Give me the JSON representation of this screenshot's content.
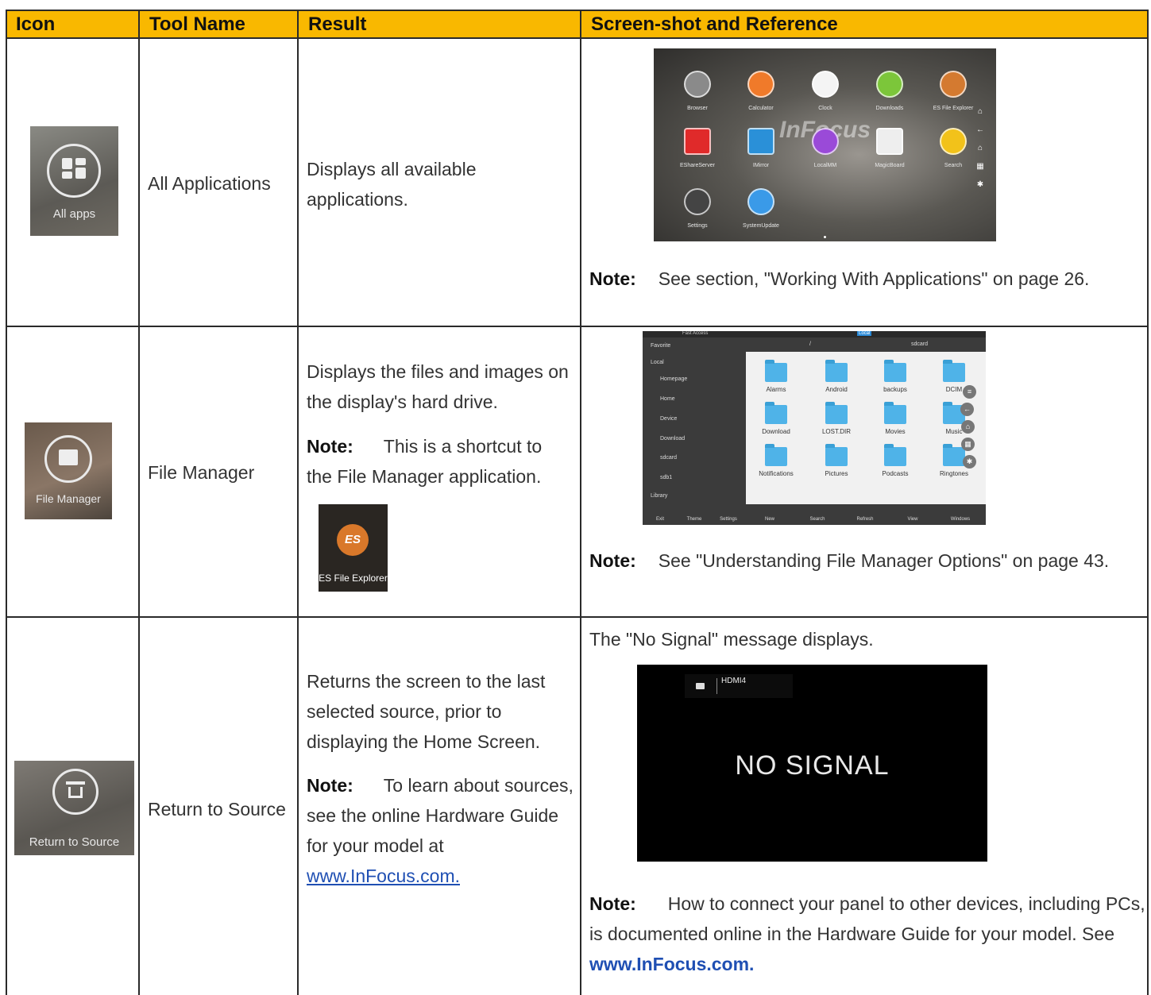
{
  "headers": [
    "Icon",
    "Tool Name",
    "Result",
    "Screen-shot and Reference"
  ],
  "rows": [
    {
      "icon_caption": "All apps",
      "tool_name": "All Applications",
      "result": "Displays all available applications.",
      "screenshot": {
        "watermark": "InFocus",
        "apps": [
          "Browser",
          "Calculator",
          "Clock",
          "Downloads",
          "ES File Explorer",
          "EShareServer",
          "IMirror",
          "LocalMM",
          "MagicBoard",
          "Search",
          "Settings",
          "SystemUpdate"
        ]
      },
      "note_label": "Note:",
      "note_text": "See section, \"Working With Applications\" on page 26."
    },
    {
      "icon_caption": "File Manager",
      "tool_name": "File Manager",
      "result": "Displays the files and images on the display's hard drive.",
      "result_note_label": "Note:",
      "result_note_text": "This is a shortcut to the File Manager application.",
      "inline_icon_caption": "ES File Explorer",
      "inline_icon_glyph": "ES",
      "screenshot": {
        "top_left": "Fast Access",
        "top_center": "Local",
        "path_root": "/",
        "path_current": "sdcard",
        "sidebar": [
          "Favorite",
          "Local",
          "Homepage",
          "Home",
          "Device",
          "Download",
          "sdcard",
          "sdb1",
          "Library"
        ],
        "folders": [
          "Alarms",
          "Android",
          "backups",
          "DCIM",
          "Download",
          "LOST.DIR",
          "Movies",
          "Music",
          "Notifications",
          "Pictures",
          "Podcasts",
          "Ringtones"
        ],
        "bottom_left": [
          "Exit",
          "Theme",
          "Settings"
        ],
        "bottom_right": [
          "New",
          "Search",
          "Refresh",
          "View",
          "Windows"
        ]
      },
      "note_label": "Note:",
      "note_text": "See \"Understanding File Manager Options\" on page 43."
    },
    {
      "icon_caption": "Return to Source",
      "tool_name": "Return to Source",
      "result": "Returns the screen to the last selected source, prior to displaying the Home Screen.",
      "result_note_label": "Note:",
      "result_note_text": "To learn about sources, see the online Hardware Guide for your model at",
      "result_link": "www.InFocus.com.",
      "intro": "The \"No Signal\" message displays.",
      "screenshot": {
        "source_label": "HDMI4",
        "message": "NO SIGNAL"
      },
      "note_label": "Note:",
      "note_text": "How to connect your panel to other devices, including PCs, is documented online in the Hardware Guide for your model. See",
      "note_link": "www.InFocus.com."
    }
  ]
}
